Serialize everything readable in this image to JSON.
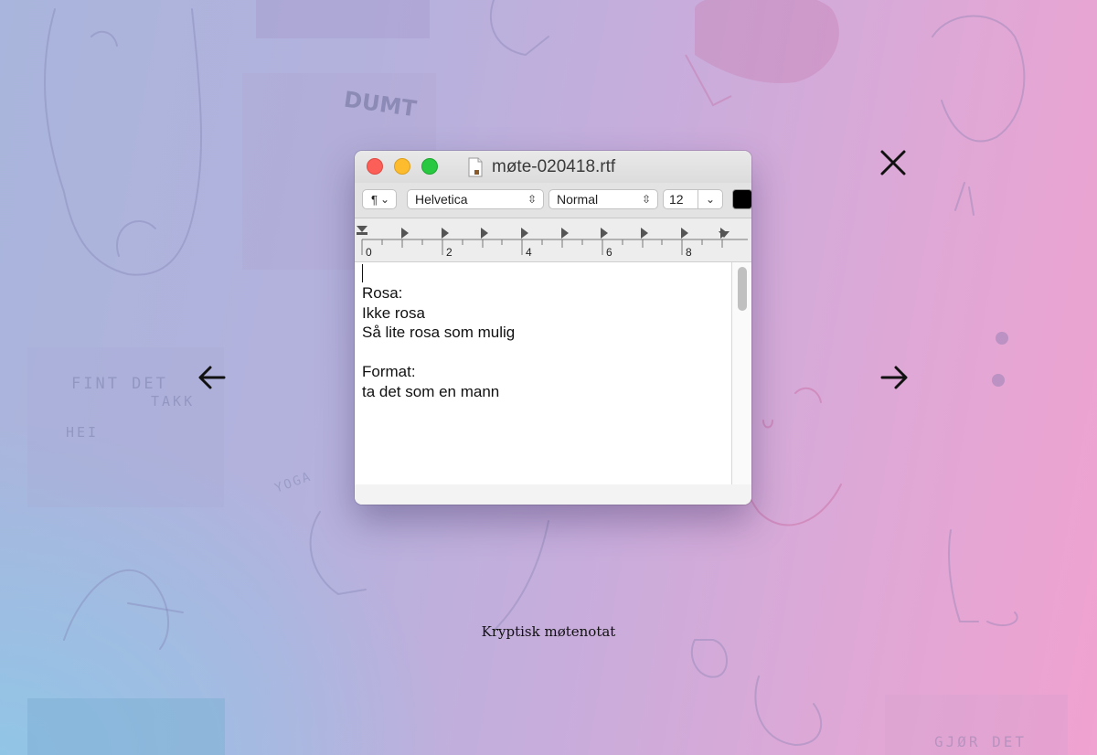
{
  "background": {
    "tile_texts": {
      "fint_det": "FINT DET",
      "takk": "TAKK",
      "hei": "HEI",
      "yoga": "YOGA",
      "dumt": "DUMT",
      "gjor_det": "GJØR DET"
    }
  },
  "window": {
    "title": "møte-020418.rtf",
    "toolbar": {
      "paragraph_symbol": "¶",
      "font": "Helvetica",
      "style": "Normal",
      "size": "12"
    },
    "ruler_labels": [
      "0",
      "2",
      "4",
      "6",
      "8"
    ],
    "document_lines": [
      "Rosa:",
      "Ikke rosa",
      "Så lite rosa som mulig",
      "",
      "Format:",
      "ta det som en mann"
    ]
  },
  "caption": "Kryptisk møtenotat",
  "colors": {
    "close_button": "#fc5f57",
    "minimize_button": "#fdbc2e",
    "zoom_button": "#28c840",
    "text_color": "#000000"
  },
  "icons": {
    "close": "close-icon",
    "previous": "arrow-left-icon",
    "next": "arrow-right-icon"
  }
}
